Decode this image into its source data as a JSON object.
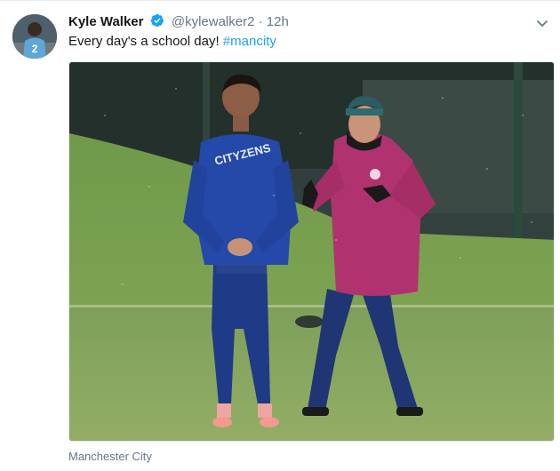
{
  "tweet": {
    "author_name": "Kyle Walker",
    "handle": "@kylewalker2",
    "separator": "·",
    "time": "12h",
    "text": "Every day's a school day! ",
    "hashtag": "#mancity",
    "location": "Manchester City",
    "avatar_number": "2",
    "jacket_text": "CITYZENS",
    "colors": {
      "name": "#14171a",
      "secondary": "#657786",
      "link": "#1da1f2",
      "verified": "#1da1f2"
    },
    "icons": {
      "verified": "verified-badge-icon",
      "caret": "chevron-down-icon"
    }
  }
}
